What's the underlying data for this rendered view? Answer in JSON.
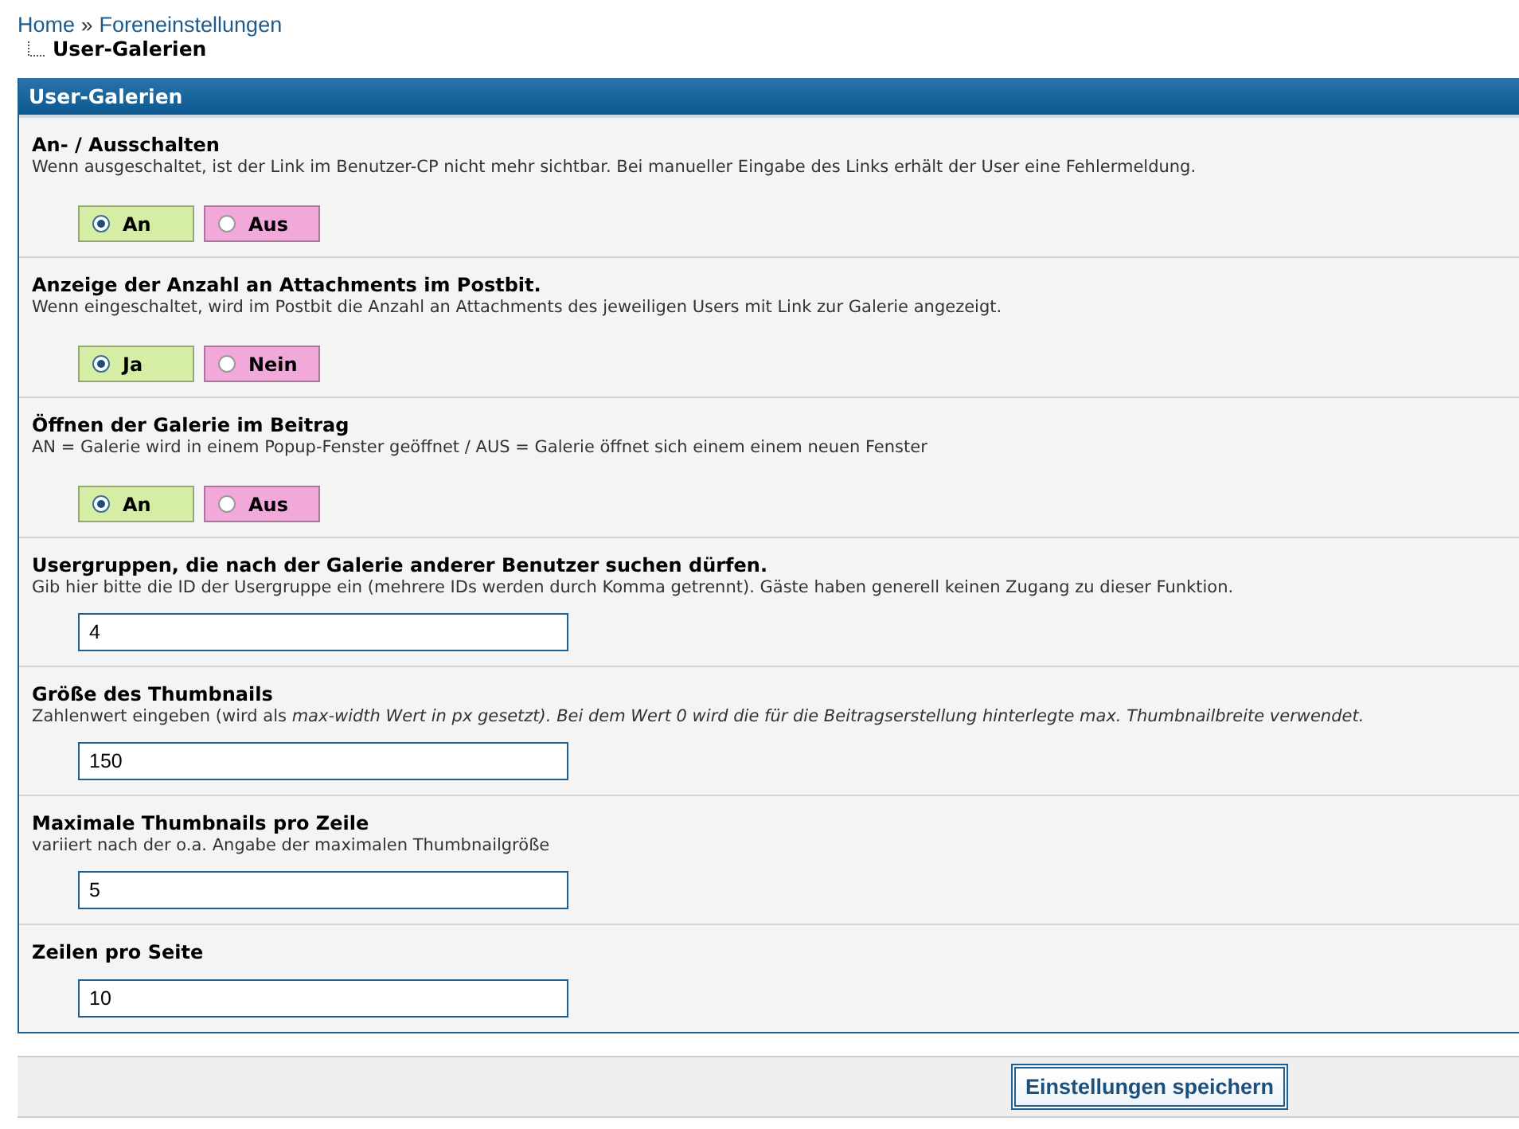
{
  "breadcrumb": {
    "links": [
      "Home",
      "Foreneinstellungen"
    ],
    "separator": "»",
    "current": "User-Galerien"
  },
  "panel": {
    "title": "User-Galerien",
    "settings": [
      {
        "kind": "radio",
        "title": "An- / Ausschalten",
        "description": "Wenn ausgeschaltet, ist der Link im Benutzer-CP nicht mehr sichtbar. Bei manueller Eingabe des Links erhält der User eine Fehlermeldung.",
        "options": [
          {
            "label": "An",
            "selected": true,
            "color": "#d6eda6"
          },
          {
            "label": "Aus",
            "selected": false,
            "color": "#f0a9d9"
          }
        ]
      },
      {
        "kind": "radio",
        "title": "Anzeige der Anzahl an Attachments im Postbit.",
        "description": "Wenn eingeschaltet, wird im Postbit die Anzahl an Attachments des jeweiligen Users mit Link zur Galerie angezeigt.",
        "options": [
          {
            "label": "Ja",
            "selected": true,
            "color": "#d6eda6"
          },
          {
            "label": "Nein",
            "selected": false,
            "color": "#f0a9d9"
          }
        ]
      },
      {
        "kind": "radio",
        "title": "Öffnen der Galerie im Beitrag",
        "description": "AN = Galerie wird in einem Popup-Fenster geöffnet / AUS = Galerie öffnet sich einem einem neuen Fenster",
        "options": [
          {
            "label": "An",
            "selected": true,
            "color": "#d6eda6"
          },
          {
            "label": "Aus",
            "selected": false,
            "color": "#f0a9d9"
          }
        ]
      },
      {
        "kind": "text",
        "title": "Usergruppen, die nach der Galerie anderer Benutzer suchen dürfen.",
        "description": "Gib hier bitte die ID der Usergruppe ein (mehrere IDs werden durch Komma getrennt). Gäste haben generell keinen Zugang zu dieser Funktion.",
        "value": "4"
      },
      {
        "kind": "text",
        "title": "Größe des Thumbnails",
        "description": "Zahlenwert eingeben (wird als *max-width Wert in px gesetzt). Bei dem Wert 0 wird die für die Beitragserstellung hinterlegte max. Thumbnailbreite verwendet.*",
        "value": "150"
      },
      {
        "kind": "text",
        "title": "Maximale Thumbnails pro Zeile",
        "description": "variiert nach der o.a. Angabe der maximalen Thumbnailgröße",
        "value": "5"
      },
      {
        "kind": "text",
        "title": "Zeilen pro Seite",
        "value": "10"
      }
    ]
  },
  "footer": {
    "save_button": "Einstellungen speichern"
  }
}
